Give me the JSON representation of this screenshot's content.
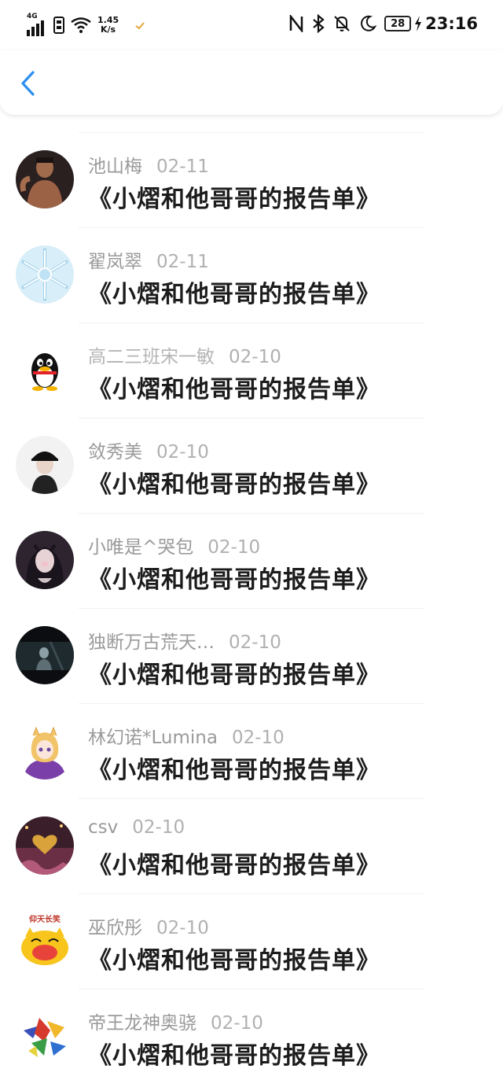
{
  "status_bar": {
    "network": "4G",
    "speed_value": "1.45",
    "speed_unit": "K/s",
    "battery": "28",
    "time": "23:16"
  },
  "nav": {
    "back_icon": "chevron-left-icon"
  },
  "items": [
    {
      "name": "池山梅",
      "date": "02-11",
      "title": "《小熠和他哥哥的报告单》",
      "avatar": "photo-avatar"
    },
    {
      "name": "翟岚翠",
      "date": "02-11",
      "title": "《小熠和他哥哥的报告单》",
      "avatar": "snowflake-avatar"
    },
    {
      "name": "高二三班宋一敏",
      "date": "02-10",
      "title": "《小熠和他哥哥的报告单》",
      "avatar": "penguin-avatar"
    },
    {
      "name": "敛秀美",
      "date": "02-10",
      "title": "《小熠和他哥哥的报告单》",
      "avatar": "photo-avatar"
    },
    {
      "name": "小唯是^哭包",
      "date": "02-10",
      "title": "《小熠和他哥哥的报告单》",
      "avatar": "photo-avatar"
    },
    {
      "name": "独断万古荒天…",
      "date": "02-10",
      "title": "《小熠和他哥哥的报告单》",
      "avatar": "photo-avatar"
    },
    {
      "name": "林幻诺*Lumina",
      "date": "02-10",
      "title": "《小熠和他哥哥的报告单》",
      "avatar": "anime-avatar"
    },
    {
      "name": "csv",
      "date": "02-10",
      "title": "《小熠和他哥哥的报告单》",
      "avatar": "photo-avatar"
    },
    {
      "name": "巫欣彤",
      "date": "02-10",
      "title": "《小熠和他哥哥的报告单》",
      "avatar": "cartoon-avatar",
      "avatar_text": "仰天长笑"
    },
    {
      "name": "帝王龙神奥骁",
      "date": "02-10",
      "title": "《小熠和他哥哥的报告单》",
      "avatar": "photo-avatar"
    }
  ],
  "colors": {
    "accent": "#2b8ff0",
    "name_text": "#9a9a9a",
    "title_text": "#1c1c1c"
  }
}
